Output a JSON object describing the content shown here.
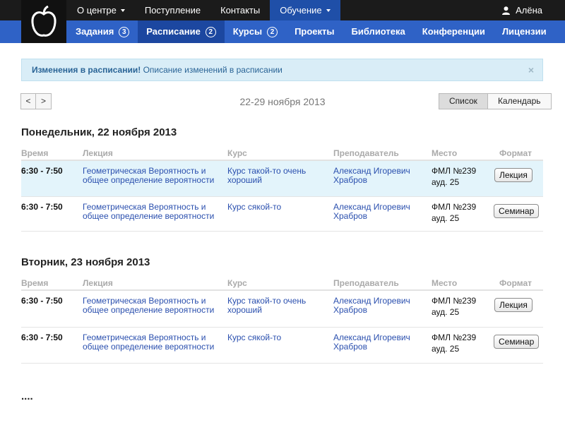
{
  "top_nav": {
    "items": [
      {
        "label": "О центре",
        "dropdown": true,
        "active": false
      },
      {
        "label": "Поступление",
        "dropdown": false,
        "active": false
      },
      {
        "label": "Контакты",
        "dropdown": false,
        "active": false
      },
      {
        "label": "Обучение",
        "dropdown": true,
        "active": true
      }
    ],
    "user_name": "Алёна"
  },
  "sub_nav": {
    "items": [
      {
        "label": "Задания",
        "badge": "3",
        "active": false
      },
      {
        "label": "Расписание",
        "badge": "2",
        "active": true
      },
      {
        "label": "Курсы",
        "badge": "2",
        "active": false
      },
      {
        "label": "Проекты",
        "badge": "",
        "active": false
      },
      {
        "label": "Библиотека",
        "badge": "",
        "active": false
      },
      {
        "label": "Конференции",
        "badge": "",
        "active": false
      },
      {
        "label": "Лицензии",
        "badge": "",
        "active": false
      }
    ]
  },
  "alert": {
    "title": "Изменения в расписании!",
    "text": "Описание изменений в расписании",
    "close": "×"
  },
  "week": {
    "prev_label": "<",
    "next_label": ">",
    "title": "22-29 ноября 2013",
    "view_list": "Список",
    "view_calendar": "Календарь"
  },
  "columns": {
    "time": "Время",
    "lecture": "Лекция",
    "course": "Курс",
    "teacher": "Преподаватель",
    "place": "Место",
    "format": "Формат"
  },
  "days": [
    {
      "title": "Понедельник, 22 ноября 2013",
      "rows": [
        {
          "time": "6:30 - 7:50",
          "lecture_1": "Геометрическая Вероятность и",
          "lecture_2": "общее определение вероятности",
          "course_1": "Курс такой-то очень",
          "course_2": "хороший",
          "teacher_1": "Александ Игоревич",
          "teacher_2": "Храбров",
          "place_1": "ФМЛ №239",
          "place_2": "ауд. 25",
          "format": "Лекция"
        },
        {
          "time": "6:30 - 7:50",
          "lecture_1": "Геометрическая Вероятность и",
          "lecture_2": "общее  определение вероятности",
          "course_1": "Курс сякой-то",
          "course_2": "",
          "teacher_1": "Александ Игоревич",
          "teacher_2": "Храбров",
          "place_1": "ФМЛ №239",
          "place_2": "ауд. 25",
          "format": "Семинар"
        }
      ]
    },
    {
      "title": "Вторник, 23 ноября 2013",
      "rows": [
        {
          "time": "6:30 - 7:50",
          "lecture_1": "Геометрическая Вероятность и",
          "lecture_2": "общее определение вероятности",
          "course_1": "Курс такой-то очень",
          "course_2": "хороший",
          "teacher_1": "Александ Игоревич",
          "teacher_2": "Храбров",
          "place_1": "ФМЛ №239",
          "place_2": "ауд. 25",
          "format": "Лекция"
        },
        {
          "time": "6:30 - 7:50",
          "lecture_1": "Геометрическая Вероятность и",
          "lecture_2": "общее  определение вероятности",
          "course_1": "Курс сякой-то",
          "course_2": "",
          "teacher_1": "Александ Игоревич",
          "teacher_2": "Храбров",
          "place_1": "ФМЛ №239",
          "place_2": "ауд. 25",
          "format": "Семинар"
        }
      ]
    }
  ],
  "ellipsis": "....",
  "colors": {
    "topbar": "#1b1b1b",
    "subbar": "#2f62c6",
    "active_top": "#1f4fa8",
    "active_sub": "#1c47a0",
    "alert_bg": "#d9edf7",
    "link": "#2a4fae",
    "highlight_row": "#e3f4fb"
  },
  "icons": {
    "logo": "apple-logo-icon",
    "user": "user-icon",
    "close": "close-icon"
  }
}
